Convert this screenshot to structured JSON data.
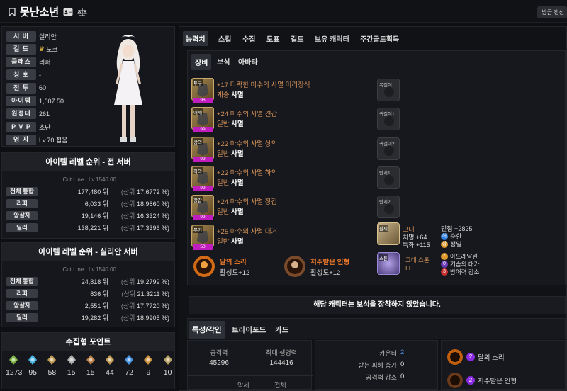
{
  "header": {
    "title": "못난소년",
    "refresh_label": "방금 갱신"
  },
  "profile": [
    {
      "label": "서 버",
      "value": "실리안"
    },
    {
      "label": "길 드",
      "value": "노크"
    },
    {
      "label": "클래스",
      "value": "리퍼"
    },
    {
      "label": "칭 호",
      "value": "-"
    },
    {
      "label": "전 투",
      "value": "60"
    },
    {
      "label": "아이템",
      "value": "1,607.50"
    },
    {
      "label": "원정대",
      "value": "261"
    },
    {
      "label": "P V P",
      "value": "초단"
    },
    {
      "label": "영 지",
      "value": "Lv.70 접음"
    }
  ],
  "rank_all": {
    "title": "아이템 레벨 순위 - 전 서버",
    "cutline": "Cut Line : Lv.1540.00",
    "rows": [
      {
        "label": "전체 통합",
        "value": "177,480 위",
        "pct_pre": "(상위",
        "pct": "17.6772 %)"
      },
      {
        "label": "리퍼",
        "value": "6,033 위",
        "pct_pre": "(상위",
        "pct": "18.9860 %)"
      },
      {
        "label": "암살자",
        "value": "19,146 위",
        "pct_pre": "(상위",
        "pct": "16.3324 %)"
      },
      {
        "label": "딜러",
        "value": "138,221 위",
        "pct_pre": "(상위",
        "pct": "17.3396 %)"
      }
    ]
  },
  "rank_server": {
    "title": "아이템 레벨 순위 - 실리안 서버",
    "cutline": "Cut Line : Lv.1540.00",
    "rows": [
      {
        "label": "전체 통합",
        "value": "24,818 위",
        "pct_pre": "(상위",
        "pct": "19.2799 %)"
      },
      {
        "label": "리퍼",
        "value": "836 위",
        "pct_pre": "(상위",
        "pct": "21.3211 %)"
      },
      {
        "label": "암살자",
        "value": "2,551 위",
        "pct_pre": "(상위",
        "pct": "17.7720 %)"
      },
      {
        "label": "딜러",
        "value": "19,282 위",
        "pct_pre": "(상위",
        "pct": "18.9905 %)"
      }
    ]
  },
  "collection": {
    "title": "수집형 포인트",
    "items": [
      {
        "icon": "mokoko-seed-icon",
        "value": "1273"
      },
      {
        "icon": "island-heart-icon",
        "value": "95"
      },
      {
        "icon": "great-painting-icon",
        "value": "58"
      },
      {
        "icon": "giant-heart-icon",
        "value": "15"
      },
      {
        "icon": "ignea-token-icon",
        "value": "15"
      },
      {
        "icon": "adventure-tome-icon",
        "value": "44"
      },
      {
        "icon": "world-tree-leaf-icon",
        "value": "72"
      },
      {
        "icon": "orpheus-star-icon",
        "value": "9"
      },
      {
        "icon": "sea-bounty-icon",
        "value": "10"
      }
    ]
  },
  "main_tabs": [
    "능력치",
    "스킬",
    "수집",
    "도표",
    "길드",
    "보유 캐릭터",
    "주간골드획득"
  ],
  "sub_tabs": [
    "장비",
    "보석",
    "아바타"
  ],
  "equipment": [
    {
      "slot": "투구",
      "quality": "96",
      "name": "+17 타락한 마수의 사멸 머리장식",
      "tier": "계승",
      "set": "사멸"
    },
    {
      "slot": "어깨",
      "quality": "99",
      "name": "+24 마수의 사멸 견갑",
      "tier": "일반",
      "set": "사멸"
    },
    {
      "slot": "상의",
      "quality": "99",
      "name": "+22 마수의 사멸 상의",
      "tier": "일반",
      "set": "사멸"
    },
    {
      "slot": "하의",
      "quality": "99",
      "name": "+22 마수의 사멸 하의",
      "tier": "일반",
      "set": "사멸"
    },
    {
      "slot": "장갑",
      "quality": "99",
      "name": "+24 마수의 사멸 장갑",
      "tier": "일반",
      "set": "사멸"
    },
    {
      "slot": "무기",
      "quality": "50",
      "name": "+25 마수의 사멸 대거",
      "tier": "일반",
      "set": "사멸"
    }
  ],
  "accessories": [
    "목걸이",
    "귀걸이1",
    "귀걸이2",
    "반지1",
    "반지2"
  ],
  "bracelet": {
    "slot": "팔찌",
    "grade": "고대",
    "stat1": "치명 +64",
    "stat2": "특화 +115",
    "stat3": "민첩 +2825",
    "effect1": "순환",
    "effect2": "정밀",
    "badge1": "허",
    "badge2": "상"
  },
  "stone": {
    "slot": "스톤",
    "name": "고대 스톤 III",
    "e1_lv": "7",
    "e1": "아드레날린",
    "e2_lv": "0",
    "e2": "기습의 대가",
    "e3_lv": "3",
    "e3": "방어력 감소"
  },
  "elixirs": [
    {
      "name": "달의 소리",
      "desc": "활성도+12"
    },
    {
      "name": "저주받은 인형",
      "desc": "활성도+12"
    }
  ],
  "gem_notice": "해당 캐릭터는 보석을 장착하지 않았습니다.",
  "lower_tabs": [
    "특성/각인",
    "트라이포드",
    "카드"
  ],
  "base_stats": {
    "atk_label": "공격력",
    "atk": "45296",
    "hp_label": "최대 생명력",
    "hp": "144416",
    "row3a": "악세",
    "row3b": "전체"
  },
  "combat_stats": [
    {
      "label": "카운터",
      "value": "2"
    },
    {
      "label": "받는 피해 증가",
      "value": "0"
    },
    {
      "label": "공격력 감소",
      "value": "0"
    }
  ],
  "engravings": [
    {
      "lv": "2",
      "name": "달의 소리"
    },
    {
      "lv": "2",
      "name": "저주받은 인형"
    }
  ]
}
